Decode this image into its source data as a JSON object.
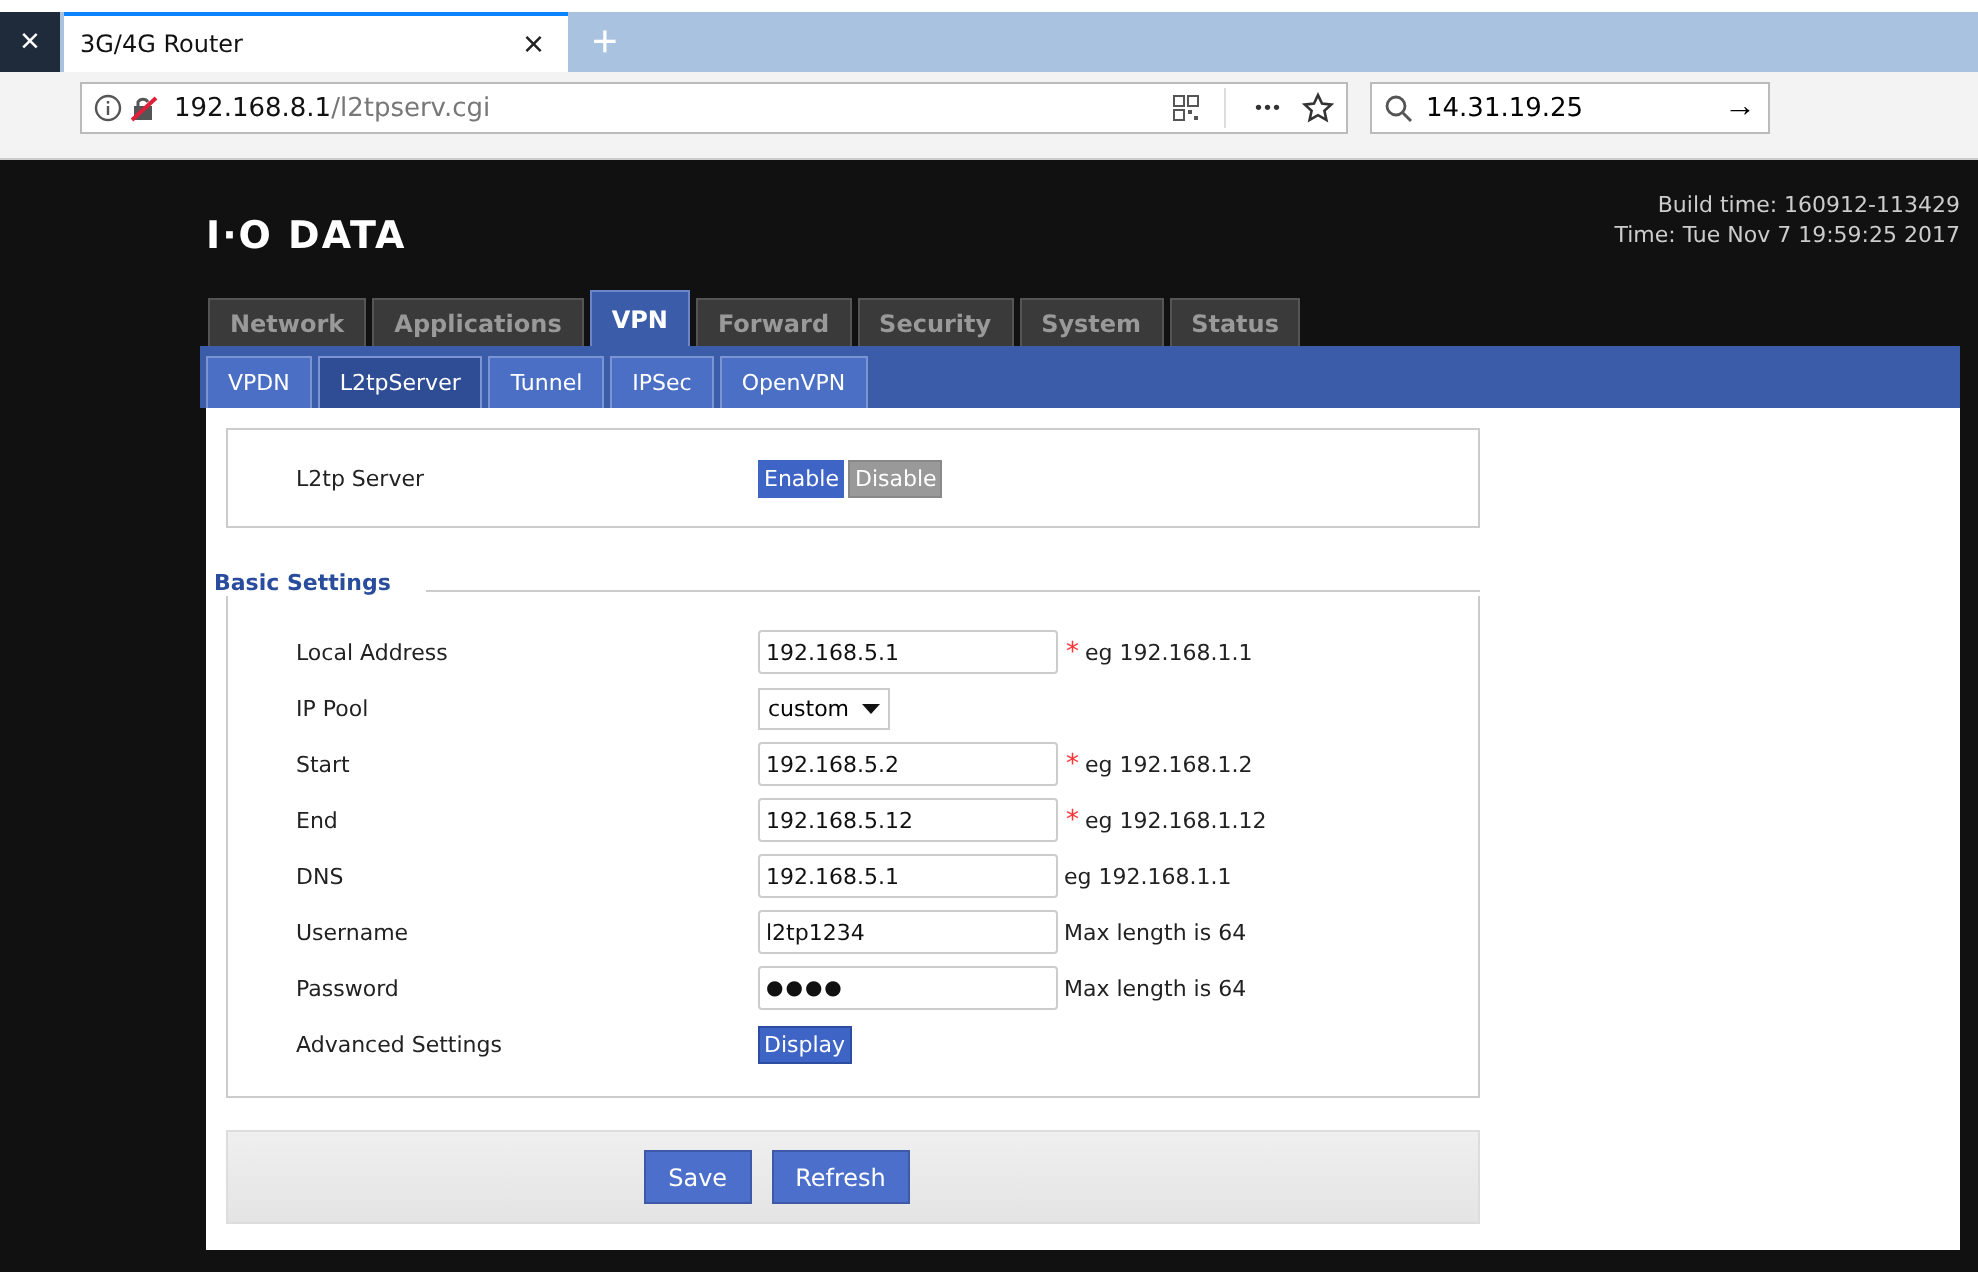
{
  "browser": {
    "close": "×",
    "tab_title": "3G/4G Router",
    "tab_close": "×",
    "new_tab": "+",
    "url_host": "192.168.8.1",
    "url_path": "/l2tpserv.cgi",
    "more": "•••",
    "search_value": "14.31.19.25",
    "go": "→"
  },
  "header": {
    "logo": "I·O DATA",
    "build_time": "Build time: 160912-113429",
    "time": "Time: Tue Nov 7 19:59:25 2017"
  },
  "main_tabs": [
    {
      "label": "Network",
      "selected": false
    },
    {
      "label": "Applications",
      "selected": false
    },
    {
      "label": "VPN",
      "selected": true
    },
    {
      "label": "Forward",
      "selected": false
    },
    {
      "label": "Security",
      "selected": false
    },
    {
      "label": "System",
      "selected": false
    },
    {
      "label": "Status",
      "selected": false
    }
  ],
  "sub_tabs": [
    {
      "label": "VPDN",
      "selected": false
    },
    {
      "label": "L2tpServer",
      "selected": true
    },
    {
      "label": "Tunnel",
      "selected": false
    },
    {
      "label": "IPSec",
      "selected": false
    },
    {
      "label": "OpenVPN",
      "selected": false
    }
  ],
  "server": {
    "label": "L2tp Server",
    "buttons": [
      {
        "label": "Enable",
        "selected": true
      },
      {
        "label": "Disable",
        "selected": false
      }
    ]
  },
  "section_title": "Basic Settings",
  "fields": [
    {
      "kind": "input",
      "label": "Local Address",
      "value": "192.168.5.1",
      "mark": "*",
      "hint": "eg 192.168.1.1"
    },
    {
      "kind": "select",
      "label": "IP Pool",
      "value": "custom"
    },
    {
      "kind": "input",
      "label": "Start",
      "value": "192.168.5.2",
      "mark": "*",
      "hint": "eg 192.168.1.2"
    },
    {
      "kind": "input",
      "label": "End",
      "value": "192.168.5.12",
      "mark": "*",
      "hint": "eg 192.168.1.12"
    },
    {
      "kind": "input",
      "label": "DNS",
      "value": "192.168.5.1",
      "hint": "eg 192.168.1.1"
    },
    {
      "kind": "input",
      "label": "Username",
      "value": "l2tp1234",
      "hint": "Max length is 64"
    },
    {
      "kind": "password",
      "label": "Password",
      "value": "●●●●",
      "hint": "Max length is 64"
    },
    {
      "kind": "button",
      "label": "Advanced Settings",
      "value": "Display"
    }
  ],
  "actions": [
    "Save",
    "Refresh"
  ]
}
